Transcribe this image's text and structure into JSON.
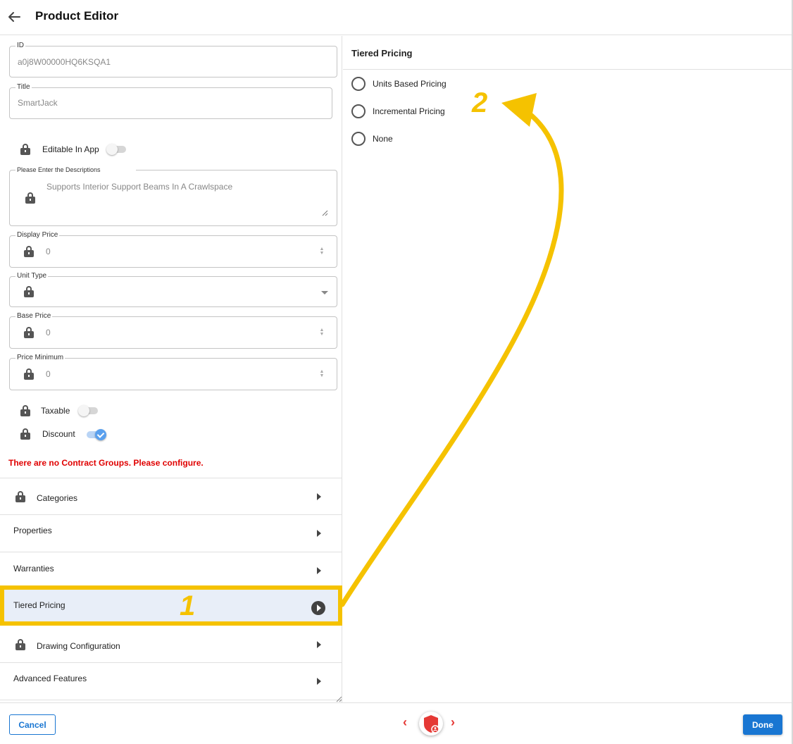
{
  "header": {
    "title": "Product Editor"
  },
  "fields": {
    "id": {
      "label": "ID",
      "value": "a0j8W00000HQ6KSQA1"
    },
    "title": {
      "label": "Title",
      "value": "SmartJack"
    },
    "editable_in_app": {
      "label": "Editable In App",
      "on": false
    },
    "description": {
      "label": "Please Enter the Descriptions",
      "value": "Supports Interior Support Beams In A Crawlspace"
    },
    "display_price": {
      "label": "Display Price",
      "value": "0"
    },
    "unit_type": {
      "label": "Unit Type",
      "value": ""
    },
    "base_price": {
      "label": "Base Price",
      "value": "0"
    },
    "price_minimum": {
      "label": "Price Minimum",
      "value": "0"
    },
    "taxable": {
      "label": "Taxable",
      "on": false
    },
    "discount": {
      "label": "Discount",
      "on": true
    }
  },
  "warning": "There are no Contract Groups. Please configure.",
  "sections": [
    {
      "label": "Categories",
      "locked": true
    },
    {
      "label": "Properties",
      "locked": false
    },
    {
      "label": "Warranties",
      "locked": false
    },
    {
      "label": "Tiered Pricing",
      "locked": false,
      "selected": true
    },
    {
      "label": "Drawing Configuration",
      "locked": true
    },
    {
      "label": "Advanced Features",
      "locked": false
    }
  ],
  "tiered_pricing": {
    "title": "Tiered Pricing",
    "options": [
      "Units Based Pricing",
      "Incremental Pricing",
      "None"
    ],
    "selected": null
  },
  "footer": {
    "cancel_label": "Cancel",
    "done_label": "Done",
    "prev_icon": "chevron-left",
    "next_icon": "chevron-right"
  },
  "annotations": {
    "step1": "1",
    "step2": "2",
    "highlight_color": "#f5c200"
  },
  "colors": {
    "accent": "#1976d2",
    "warning": "#e00000",
    "nav": "#e53935"
  }
}
